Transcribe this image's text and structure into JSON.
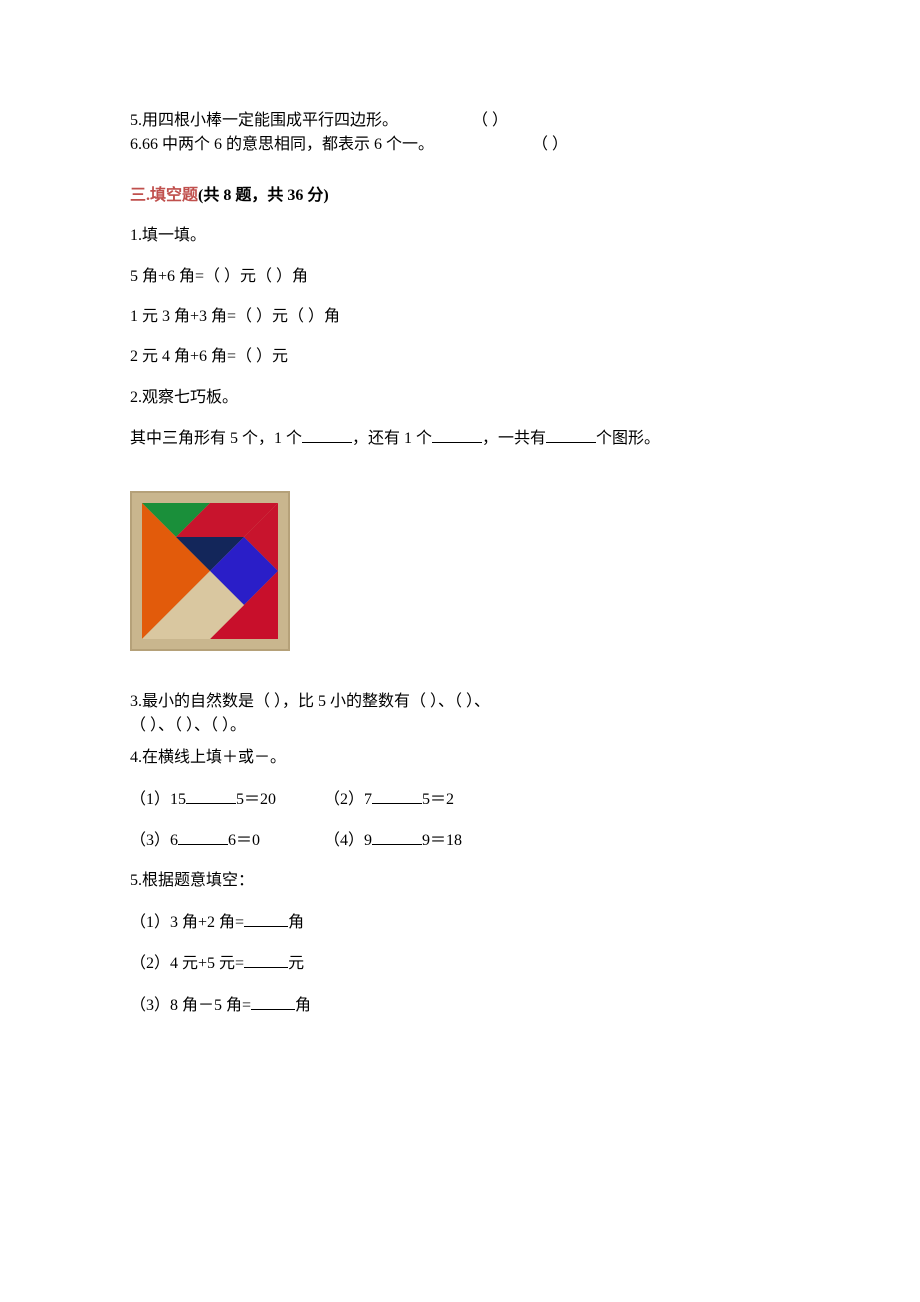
{
  "top": {
    "q5": "5.用四根小棒一定能围成平行四边形。",
    "q5_blank": "（    ）",
    "q6": "6.66 中两个 6 的意思相同，都表示 6 个一。",
    "q6_blank": "（    ）"
  },
  "section3": {
    "prefix": "三.",
    "main": "填空题",
    "rest": "(共 8 题，共 36 分)"
  },
  "q1": {
    "title": "1.填一填。",
    "line1_a": "5 角+6 角=（    ）元（    ）角",
    "line2_a": "1 元 3 角+3 角=（    ）元（    ）角",
    "line3_a": "2 元 4 角+6 角=（    ）元"
  },
  "q2": {
    "title": "2.观察七巧板。",
    "line1_pre": "其中三角形有 5 个，1 个",
    "line1_mid": "，还有 1 个",
    "line1_post": "，一共有",
    "line1_end": "个图形。"
  },
  "q3": {
    "l1": "3.最小的自然数是（    ），比 5 小的整数有（    ）、（    ）、",
    "l2": "（    ）、（    ）、（    ）。"
  },
  "q4": {
    "title": "4.在横线上填＋或－。",
    "r1a_pre": "（1）15",
    "r1a_post": "5＝20",
    "r1b_pre": "（2）7",
    "r1b_post": "5＝2",
    "r2a_pre": "（3）6",
    "r2a_post": "6＝0",
    "r2b_pre": "（4）9",
    "r2b_post": "9＝18"
  },
  "q5": {
    "title": "5.根据题意填空：",
    "l1_pre": "（1）3 角+2 角=",
    "l1_post": "角",
    "l2_pre": "（2）4 元+5 元=",
    "l2_post": "元",
    "l3_pre": "（3）8 角－5 角=",
    "l3_post": "角"
  }
}
